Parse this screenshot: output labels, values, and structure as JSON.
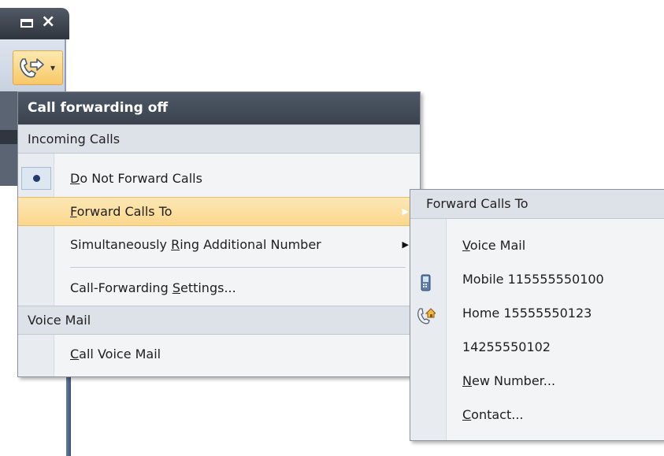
{
  "window": {
    "maximize_icon": "maximize-icon",
    "close_glyph": "×",
    "toolbar_icon": "call-forward-icon"
  },
  "menu": {
    "header": "Call forwarding off",
    "section_incoming": "Incoming Calls",
    "items": [
      {
        "pre": "",
        "key": "D",
        "post": "o Not Forward Calls",
        "checked": true
      },
      {
        "pre": "",
        "key": "F",
        "post": "orward Calls To",
        "submenu": true,
        "highlighted": true
      },
      {
        "pre": "Simultaneously ",
        "key": "R",
        "post": "ing Additional Number",
        "submenu": true
      },
      {
        "pre": "Call-Forwarding ",
        "key": "S",
        "post": "ettings..."
      }
    ],
    "section_voicemail": "Voice Mail",
    "voicemail_item": {
      "pre": "",
      "key": "C",
      "post": "all Voice Mail"
    }
  },
  "submenu": {
    "header": "Forward Calls To",
    "items": [
      {
        "pre": "",
        "key": "V",
        "post": "oice Mail",
        "icon": ""
      },
      {
        "pre": "Mobile 115555550100",
        "key": "",
        "post": "",
        "icon": "mobile-phone-icon"
      },
      {
        "pre": "Home 15555550123",
        "key": "",
        "post": "",
        "icon": "home-phone-icon"
      },
      {
        "pre": "14255550102",
        "key": "",
        "post": "",
        "icon": ""
      },
      {
        "pre": "",
        "key": "N",
        "post": "ew Number...",
        "icon": ""
      },
      {
        "pre": "",
        "key": "C",
        "post": "ontact...",
        "icon": ""
      }
    ]
  },
  "colors": {
    "highlight": "#fbd78c",
    "header_bg": "#3a424e",
    "radio_dot": "#223a70"
  }
}
